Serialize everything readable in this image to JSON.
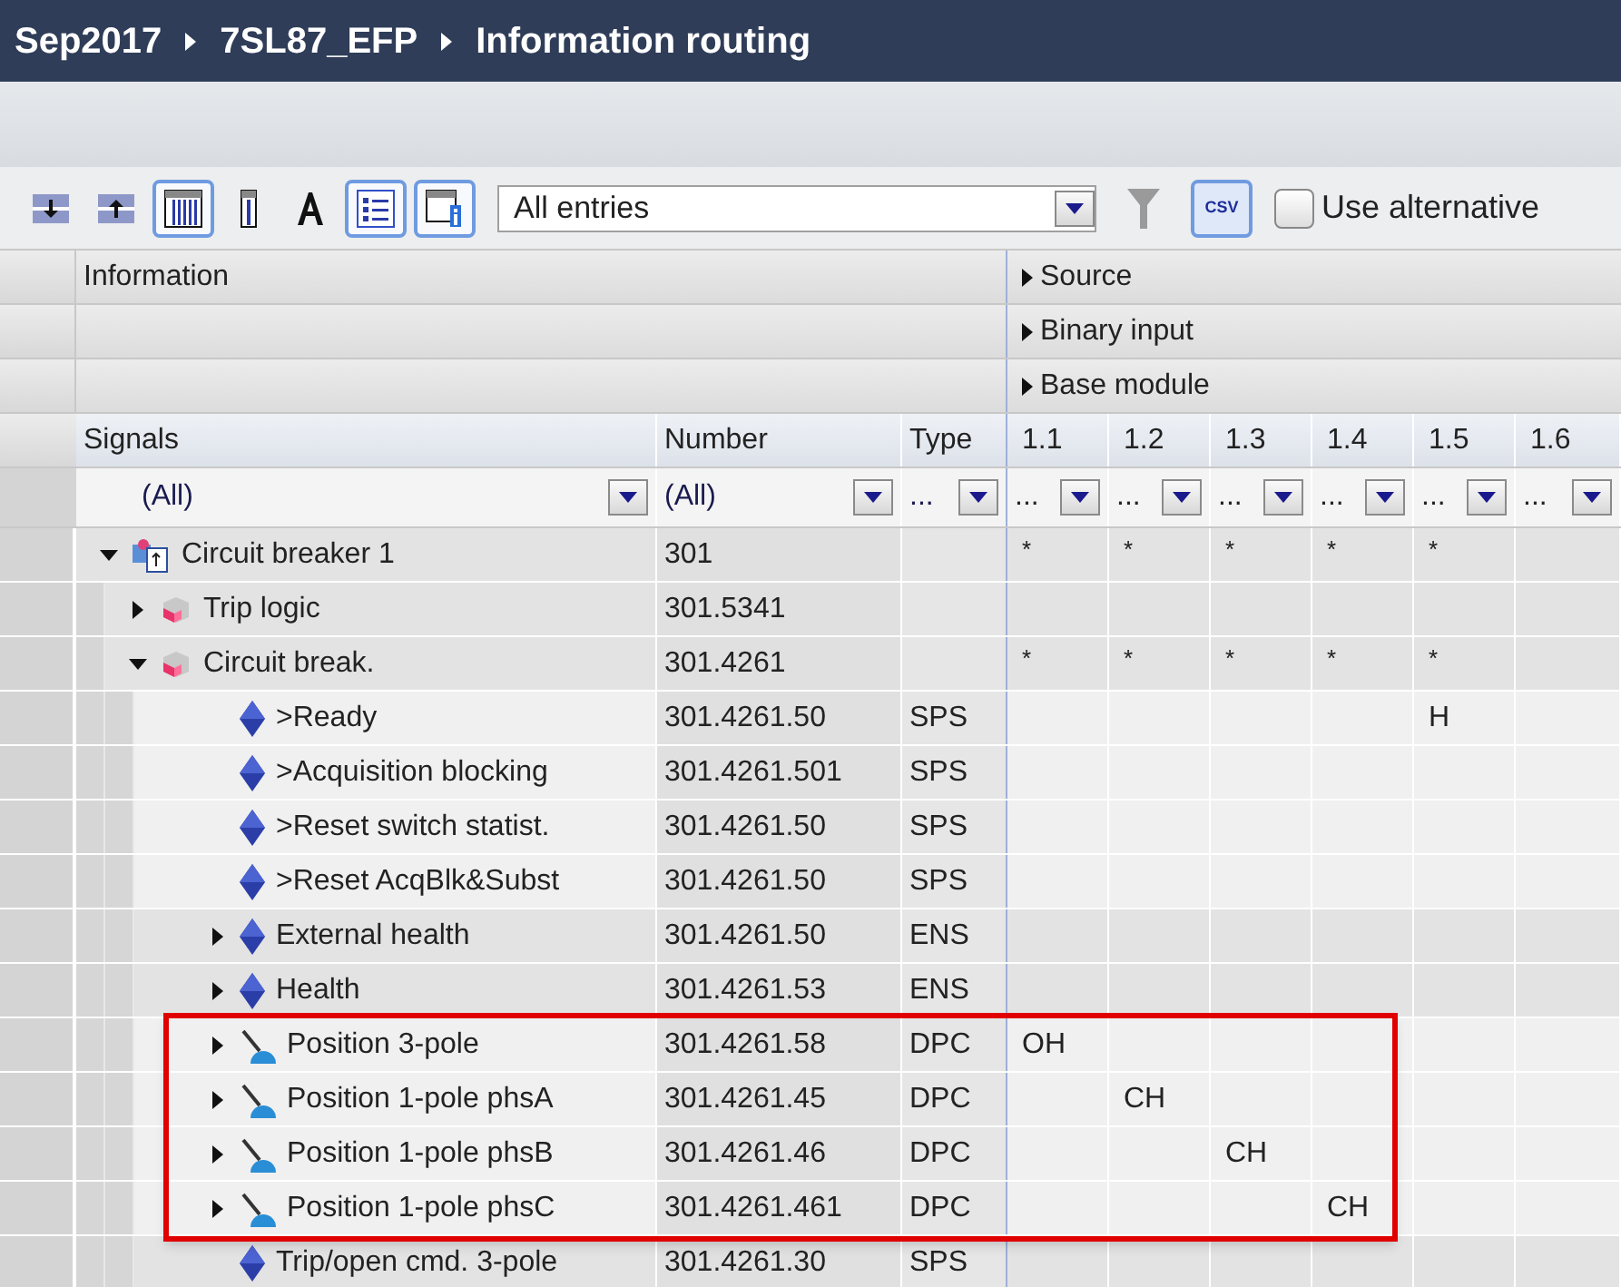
{
  "breadcrumb": [
    "Sep2017",
    "7SL87_EFP",
    "Information routing"
  ],
  "toolbar": {
    "buttons": [
      {
        "kind": "expand",
        "selected": false
      },
      {
        "kind": "collapse",
        "selected": false
      },
      {
        "kind": "columns",
        "selected": true
      },
      {
        "kind": "column",
        "selected": false
      },
      {
        "kind": "font",
        "selected": false
      },
      {
        "kind": "list",
        "selected": true
      },
      {
        "kind": "info",
        "selected": true
      }
    ],
    "filter": {
      "value": "All entries"
    },
    "csv": {
      "label": "CSV",
      "selected": true
    },
    "alternative": {
      "label": "Use alternative",
      "checked": false
    }
  },
  "header": {
    "information": "Information",
    "groups": [
      {
        "label": "Source"
      },
      {
        "label": "Binary input"
      },
      {
        "label": "Base module"
      }
    ],
    "columns": [
      {
        "label": "Signals",
        "filter": "(All)"
      },
      {
        "label": "Number",
        "filter": "(All)"
      },
      {
        "label": "Type",
        "filter": "..."
      }
    ],
    "matrix_columns": [
      {
        "label": "1.1",
        "filter": "..."
      },
      {
        "label": "1.2",
        "filter": "..."
      },
      {
        "label": "1.3",
        "filter": "..."
      },
      {
        "label": "1.4",
        "filter": "..."
      },
      {
        "label": "1.5",
        "filter": "..."
      },
      {
        "label": "1.6",
        "filter": "..."
      }
    ]
  },
  "tree": [
    {
      "kind": "device",
      "label": "Circuit breaker 1",
      "number": "301",
      "expanded": true,
      "shaded": true,
      "boxed": false,
      "cells": [
        "*",
        "*",
        "*",
        "*",
        "*",
        null
      ],
      "children": [
        {
          "kind": "block",
          "label": "Trip logic",
          "number": "301.5341",
          "expanded": false,
          "shaded": true,
          "boxed": false,
          "cells": [
            null,
            null,
            null,
            null,
            null,
            null
          ]
        },
        {
          "kind": "block",
          "label": "Circuit break.",
          "number": "301.4261",
          "expanded": true,
          "shaded": true,
          "boxed": false,
          "cells": [
            "*",
            "*",
            "*",
            "*",
            "*",
            null
          ],
          "children": [
            {
              "kind": "signal",
              "label": ">Ready",
              "number": "301.4261.50",
              "type": "SPS",
              "shaded": false,
              "boxed": false,
              "cells": [
                null,
                null,
                null,
                null,
                "H",
                null
              ]
            },
            {
              "kind": "signal",
              "label": ">Acquisition blocking",
              "number": "301.4261.501",
              "type": "SPS",
              "shaded": false,
              "boxed": false,
              "cells": [
                null,
                null,
                null,
                null,
                null,
                null
              ]
            },
            {
              "kind": "signal",
              "label": ">Reset switch statist.",
              "number": "301.4261.50",
              "type": "SPS",
              "shaded": false,
              "boxed": false,
              "cells": [
                null,
                null,
                null,
                null,
                null,
                null
              ]
            },
            {
              "kind": "signal",
              "label": ">Reset AcqBlk&Subst",
              "number": "301.4261.50",
              "type": "SPS",
              "shaded": false,
              "boxed": false,
              "cells": [
                null,
                null,
                null,
                null,
                null,
                null
              ]
            },
            {
              "kind": "signal",
              "label": "External health",
              "number": "301.4261.50",
              "type": "ENS",
              "expanded": false,
              "shaded": true,
              "boxed": false,
              "cells": [
                null,
                null,
                null,
                null,
                null,
                null
              ]
            },
            {
              "kind": "signal",
              "label": "Health",
              "number": "301.4261.53",
              "type": "ENS",
              "expanded": false,
              "shaded": true,
              "boxed": false,
              "cells": [
                null,
                null,
                null,
                null,
                null,
                null
              ]
            },
            {
              "kind": "switch",
              "label": "Position 3-pole",
              "number": "301.4261.58",
              "type": "DPC",
              "expanded": false,
              "shaded": false,
              "boxed": true,
              "cells": [
                "OH",
                null,
                null,
                null,
                null,
                null
              ]
            },
            {
              "kind": "switch",
              "label": "Position 1-pole phsA",
              "number": "301.4261.45",
              "type": "DPC",
              "expanded": false,
              "shaded": false,
              "boxed": true,
              "cells": [
                null,
                "CH",
                null,
                null,
                null,
                null
              ]
            },
            {
              "kind": "switch",
              "label": "Position 1-pole phsB",
              "number": "301.4261.46",
              "type": "DPC",
              "expanded": false,
              "shaded": false,
              "boxed": true,
              "cells": [
                null,
                null,
                "CH",
                null,
                null,
                null
              ]
            },
            {
              "kind": "switch",
              "label": "Position 1-pole phsC",
              "number": "301.4261.461",
              "type": "DPC",
              "expanded": false,
              "shaded": false,
              "boxed": true,
              "cells": [
                null,
                null,
                null,
                "CH",
                null,
                null
              ]
            },
            {
              "kind": "signal",
              "label": "Trip/open cmd. 3-pole",
              "number": "301.4261.30",
              "type": "SPS",
              "shaded": true,
              "boxed": false,
              "cells": [
                null,
                null,
                null,
                null,
                null,
                null
              ]
            }
          ]
        }
      ]
    }
  ]
}
